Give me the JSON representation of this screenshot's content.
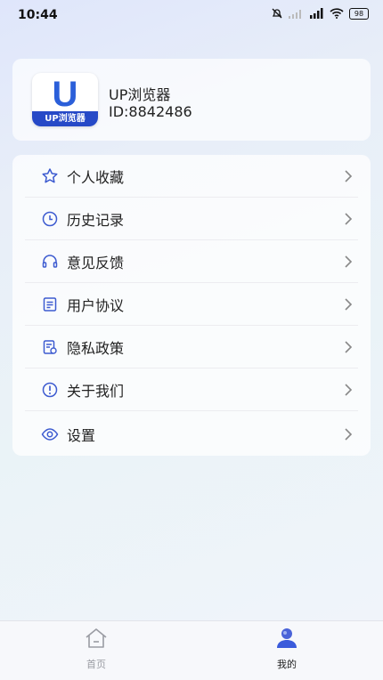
{
  "status": {
    "time": "10:44",
    "battery": "98"
  },
  "profile": {
    "logo_text": "UP浏览器",
    "name": "UP浏览器",
    "id": "ID:8842486"
  },
  "menu": [
    {
      "label": "个人收藏",
      "icon": "star-icon"
    },
    {
      "label": "历史记录",
      "icon": "clock-icon"
    },
    {
      "label": "意见反馈",
      "icon": "headset-icon"
    },
    {
      "label": "用户协议",
      "icon": "document-icon"
    },
    {
      "label": "隐私政策",
      "icon": "privacy-doc-icon"
    },
    {
      "label": "关于我们",
      "icon": "info-icon"
    },
    {
      "label": "设置",
      "icon": "settings-eye-icon"
    }
  ],
  "tabs": [
    {
      "label": "首页",
      "icon": "home-icon",
      "active": false
    },
    {
      "label": "我的",
      "icon": "user-icon",
      "active": true
    }
  ],
  "colors": {
    "accent": "#3b5bdb",
    "icon": "#3d5bd0",
    "inactive_tab": "#9a9ca3"
  }
}
